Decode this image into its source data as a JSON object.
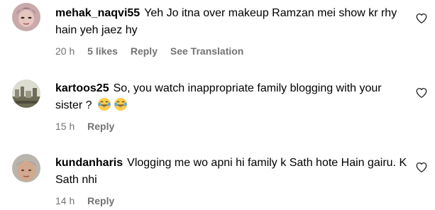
{
  "comments": [
    {
      "username": "mehak_naqvi55",
      "text": "Yeh Jo itna over makeup Ramzan mei show kr rhy hain yeh jaez hy",
      "time": "20 h",
      "likes": "5 likes",
      "reply": "Reply",
      "translation": "See Translation",
      "avatar_icon": "user-avatar",
      "heart_icon": "heart-outline-icon"
    },
    {
      "username": "kartoos25",
      "text": "So, you watch inappropriate family blogging with your sister ?",
      "emoji_icon": "tears-of-joy-emoji",
      "time": "15 h",
      "reply": "Reply",
      "avatar_icon": "user-avatar",
      "heart_icon": "heart-outline-icon"
    },
    {
      "username": "kundanharis",
      "text": "Vlogging me wo apni hi family k Sath hote Hain gairu. K Sath nhi",
      "time": "14 h",
      "reply": "Reply",
      "avatar_icon": "user-avatar",
      "heart_icon": "heart-outline-icon"
    }
  ]
}
